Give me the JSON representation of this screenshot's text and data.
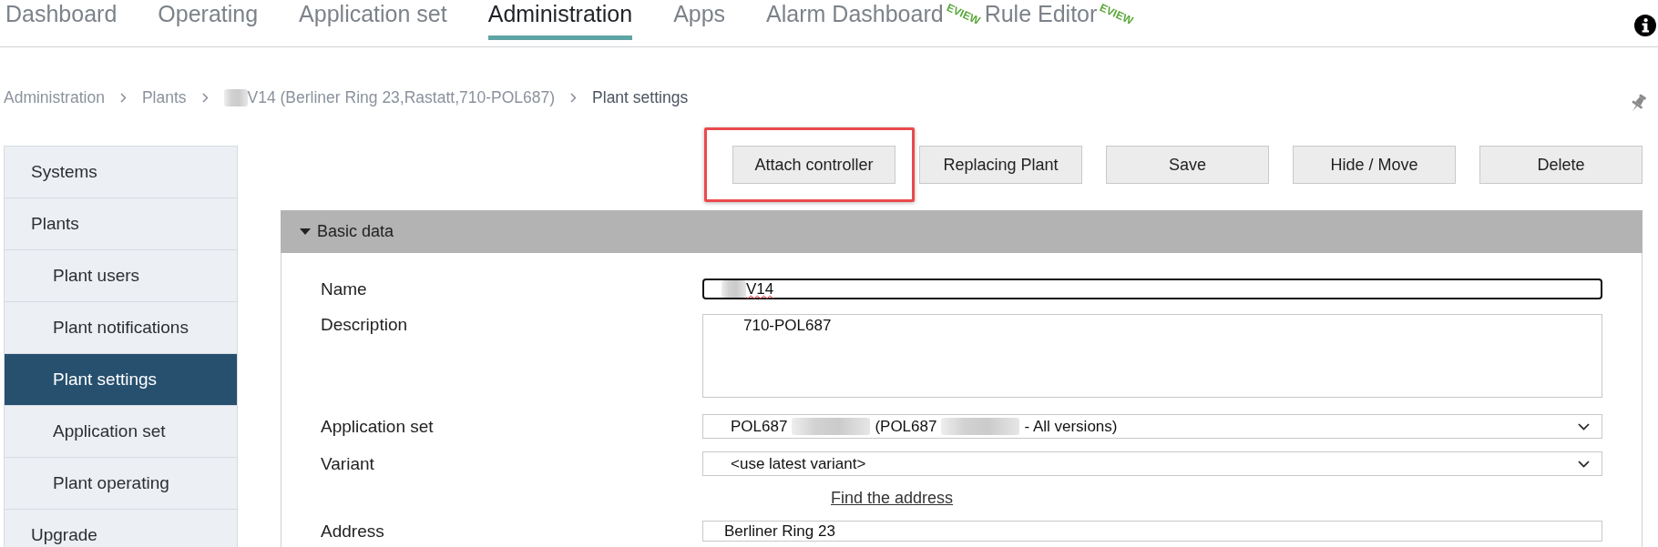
{
  "top_nav": {
    "tabs": [
      {
        "label": "Dashboard",
        "selected": false
      },
      {
        "label": "Operating",
        "selected": false
      },
      {
        "label": "Application set",
        "selected": false
      },
      {
        "label": "Administration",
        "selected": true
      },
      {
        "label": "Apps",
        "selected": false
      },
      {
        "label": "Alarm Dashboard",
        "selected": false,
        "badge": "EVIEW"
      },
      {
        "label": "Rule Editor",
        "selected": false,
        "badge": "EVIEW"
      }
    ]
  },
  "breadcrumb": [
    {
      "current": false,
      "parts": [
        {
          "kind": "text",
          "text": "Administration"
        }
      ]
    },
    {
      "current": false,
      "parts": [
        {
          "kind": "text",
          "text": "Plants"
        }
      ]
    },
    {
      "current": false,
      "parts": [
        {
          "kind": "blur"
        },
        {
          "kind": "text",
          "text": "V14 (Berliner Ring 23,Rastatt,710-POL687)"
        }
      ]
    },
    {
      "current": true,
      "parts": [
        {
          "kind": "text",
          "text": "Plant settings"
        }
      ]
    }
  ],
  "sidebar": {
    "items": [
      {
        "label": "Systems",
        "selected": false
      },
      {
        "label": "Plants",
        "selected": false,
        "children": [
          {
            "label": "Plant users",
            "selected": false
          },
          {
            "label": "Plant notifications",
            "selected": false
          },
          {
            "label": "Plant settings",
            "selected": true
          },
          {
            "label": "Application set",
            "selected": false
          },
          {
            "label": "Plant operating",
            "selected": false
          }
        ]
      },
      {
        "label": "Upgrade",
        "selected": false
      }
    ]
  },
  "toolbar": {
    "buttons": [
      {
        "label": "Attach controller",
        "highlighted": true
      },
      {
        "label": "Replacing Plant",
        "highlighted": false
      },
      {
        "label": "Save",
        "highlighted": false
      },
      {
        "label": "Hide / Move",
        "highlighted": false
      },
      {
        "label": "Delete",
        "highlighted": false
      }
    ]
  },
  "panel": {
    "title": "Basic data",
    "expanded": true,
    "fields": [
      {
        "kind": "text",
        "label": "Name",
        "focused": true,
        "parts": [
          {
            "kind": "blur"
          },
          {
            "kind": "text",
            "text": "V14",
            "spellcheck_error": true
          }
        ]
      },
      {
        "kind": "textarea",
        "label": "Description",
        "focused": false,
        "parts": [
          {
            "kind": "text",
            "text": "710-POL687",
            "spellcheck_error": false
          }
        ]
      },
      {
        "kind": "select",
        "label": "Application set",
        "focused": false,
        "parts": [
          {
            "kind": "text",
            "text": "POL687",
            "spellcheck_error": false
          },
          {
            "kind": "blur"
          },
          {
            "kind": "text",
            "text": "(POL687",
            "spellcheck_error": false
          },
          {
            "kind": "blur"
          },
          {
            "kind": "text",
            "text": "- All versions)",
            "spellcheck_error": false
          }
        ]
      },
      {
        "kind": "select",
        "label": "Variant",
        "focused": false,
        "parts": [
          {
            "kind": "text",
            "text": "<use latest variant>",
            "spellcheck_error": false
          }
        ]
      },
      {
        "kind": "link",
        "label": "Find the address"
      },
      {
        "kind": "text",
        "label": "Address",
        "focused": false,
        "parts": [
          {
            "kind": "text",
            "text": "Berliner Ring 23",
            "spellcheck_error": false
          }
        ]
      }
    ]
  }
}
